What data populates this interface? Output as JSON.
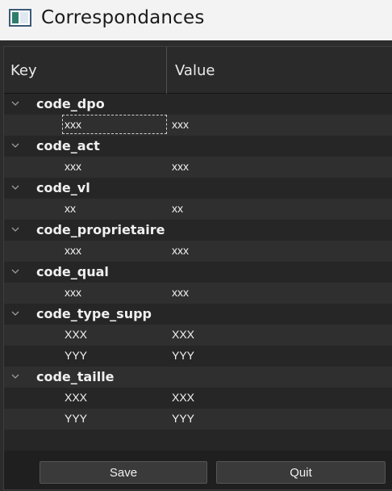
{
  "window": {
    "title": "Correspondances"
  },
  "tree": {
    "columns": [
      "Key",
      "Value"
    ],
    "groups": [
      {
        "key": "code_dpo",
        "items": [
          {
            "key": "xxx",
            "value": "xxx"
          }
        ]
      },
      {
        "key": "code_act",
        "items": [
          {
            "key": "xxx",
            "value": "xxx"
          }
        ]
      },
      {
        "key": "code_vl",
        "items": [
          {
            "key": "xx",
            "value": "xx"
          }
        ]
      },
      {
        "key": "code_proprietaire",
        "items": [
          {
            "key": "xxx",
            "value": "xxx"
          }
        ]
      },
      {
        "key": "code_qual",
        "items": [
          {
            "key": "xxx",
            "value": "xxx"
          }
        ]
      },
      {
        "key": "code_type_supp",
        "items": [
          {
            "key": "XXX",
            "value": "XXX"
          },
          {
            "key": "YYY",
            "value": "YYY"
          }
        ]
      },
      {
        "key": "code_taille",
        "items": [
          {
            "key": "XXX",
            "value": "XXX"
          },
          {
            "key": "YYY",
            "value": "YYY"
          }
        ]
      }
    ],
    "focused_cell": "code_dpo.0.key"
  },
  "buttons": {
    "save_label": "Save",
    "quit_label": "Quit"
  },
  "icons": {
    "app": "window-app-icon",
    "expand": "chevron-down-icon"
  }
}
